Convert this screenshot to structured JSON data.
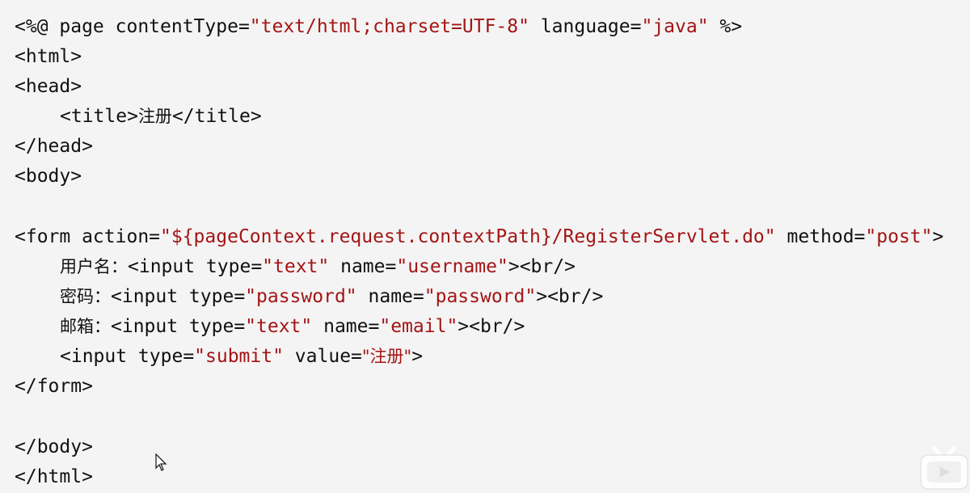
{
  "code": {
    "line1": {
      "p1": "<%@ page contentType=",
      "v1": "\"text/html;charset=UTF-8\"",
      "p2": " language=",
      "v2": "\"java\"",
      "p3": " %>"
    },
    "line2": "<html>",
    "line3": "<head>",
    "line4": {
      "p1": "<title>",
      "cjk": "注册",
      "p2": "</title>"
    },
    "line5": "</head>",
    "line6": "<body>",
    "line8": {
      "p1": "<form action=",
      "v1": "\"${pageContext.request.contextPath}/RegisterServlet.do\"",
      "p2": " method=",
      "v2": "\"post\"",
      "p3": ">"
    },
    "line9": {
      "cjk": "用户名：",
      "p1": "<input type=",
      "v1": "\"text\"",
      "p2": " name=",
      "v2": "\"username\"",
      "p3": "><br/>"
    },
    "line10": {
      "cjk": "密码：",
      "p1": "<input type=",
      "v1": "\"password\"",
      "p2": " name=",
      "v2": "\"password\"",
      "p3": "><br/>"
    },
    "line11": {
      "cjk": "邮箱：",
      "p1": "<input type=",
      "v1": "\"text\"",
      "p2": " name=",
      "v2": "\"email\"",
      "p3": "><br/>"
    },
    "line12": {
      "p1": "<input type=",
      "v1": "\"submit\"",
      "p2": " value=",
      "v2": "\"注册\"",
      "p3": ">"
    },
    "line13": "</form>",
    "line15": "</body>",
    "line16": "</html>"
  },
  "colors": {
    "background": "#f4f4f4",
    "text": "#111111",
    "string": "#a31515"
  },
  "icons": {
    "cursor": "mouse-pointer-icon",
    "watermark": "bilibili-tv-icon"
  }
}
